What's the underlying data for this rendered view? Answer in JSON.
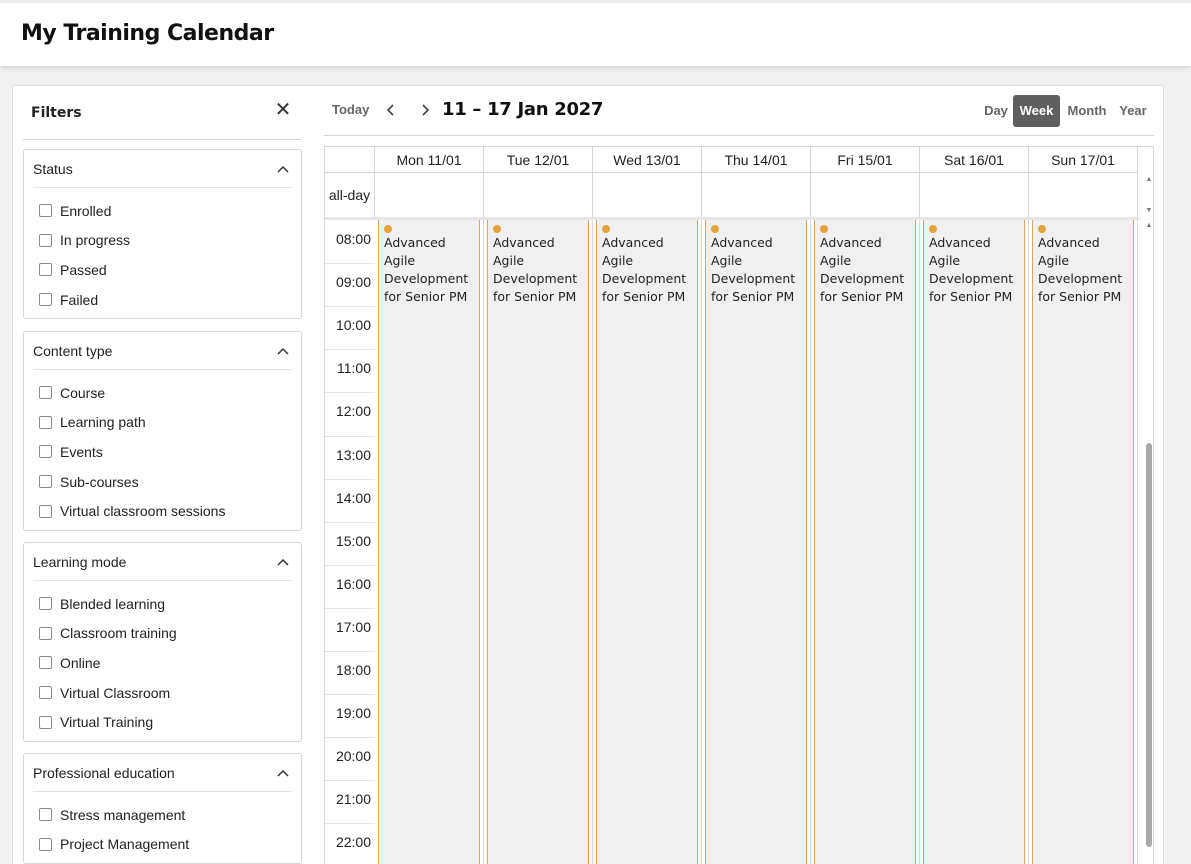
{
  "page": {
    "title": "My Training Calendar"
  },
  "filters": {
    "title": "Filters",
    "close_icon": "close-icon",
    "groups": [
      {
        "title": "Status",
        "items": [
          "Enrolled",
          "In progress",
          "Passed",
          "Failed"
        ]
      },
      {
        "title": "Content type",
        "items": [
          "Course",
          "Learning path",
          "Events",
          "Sub-courses",
          "Virtual classroom sessions"
        ]
      },
      {
        "title": "Learning mode",
        "items": [
          "Blended learning",
          "Classroom training",
          "Online",
          "Virtual Classroom",
          "Virtual Training"
        ]
      },
      {
        "title": "Professional education",
        "items": [
          "Stress management",
          "Project Management"
        ]
      }
    ]
  },
  "toolbar": {
    "today": "Today",
    "range": "11 – 17 Jan 2027",
    "views": [
      "Day",
      "Week",
      "Month",
      "Year"
    ],
    "active_view": "Week"
  },
  "calendar": {
    "allday_label": "all-day",
    "days": [
      "Mon 11/01",
      "Tue 12/01",
      "Wed 13/01",
      "Thu 14/01",
      "Fri 15/01",
      "Sat 16/01",
      "Sun 17/01"
    ],
    "hours": [
      "08:00",
      "09:00",
      "10:00",
      "11:00",
      "12:00",
      "13:00",
      "14:00",
      "15:00",
      "16:00",
      "17:00",
      "18:00",
      "19:00",
      "20:00",
      "21:00",
      "22:00"
    ],
    "event_title": "Advanced Agile Development for Senior PM",
    "event_color": "#e8a23a"
  }
}
